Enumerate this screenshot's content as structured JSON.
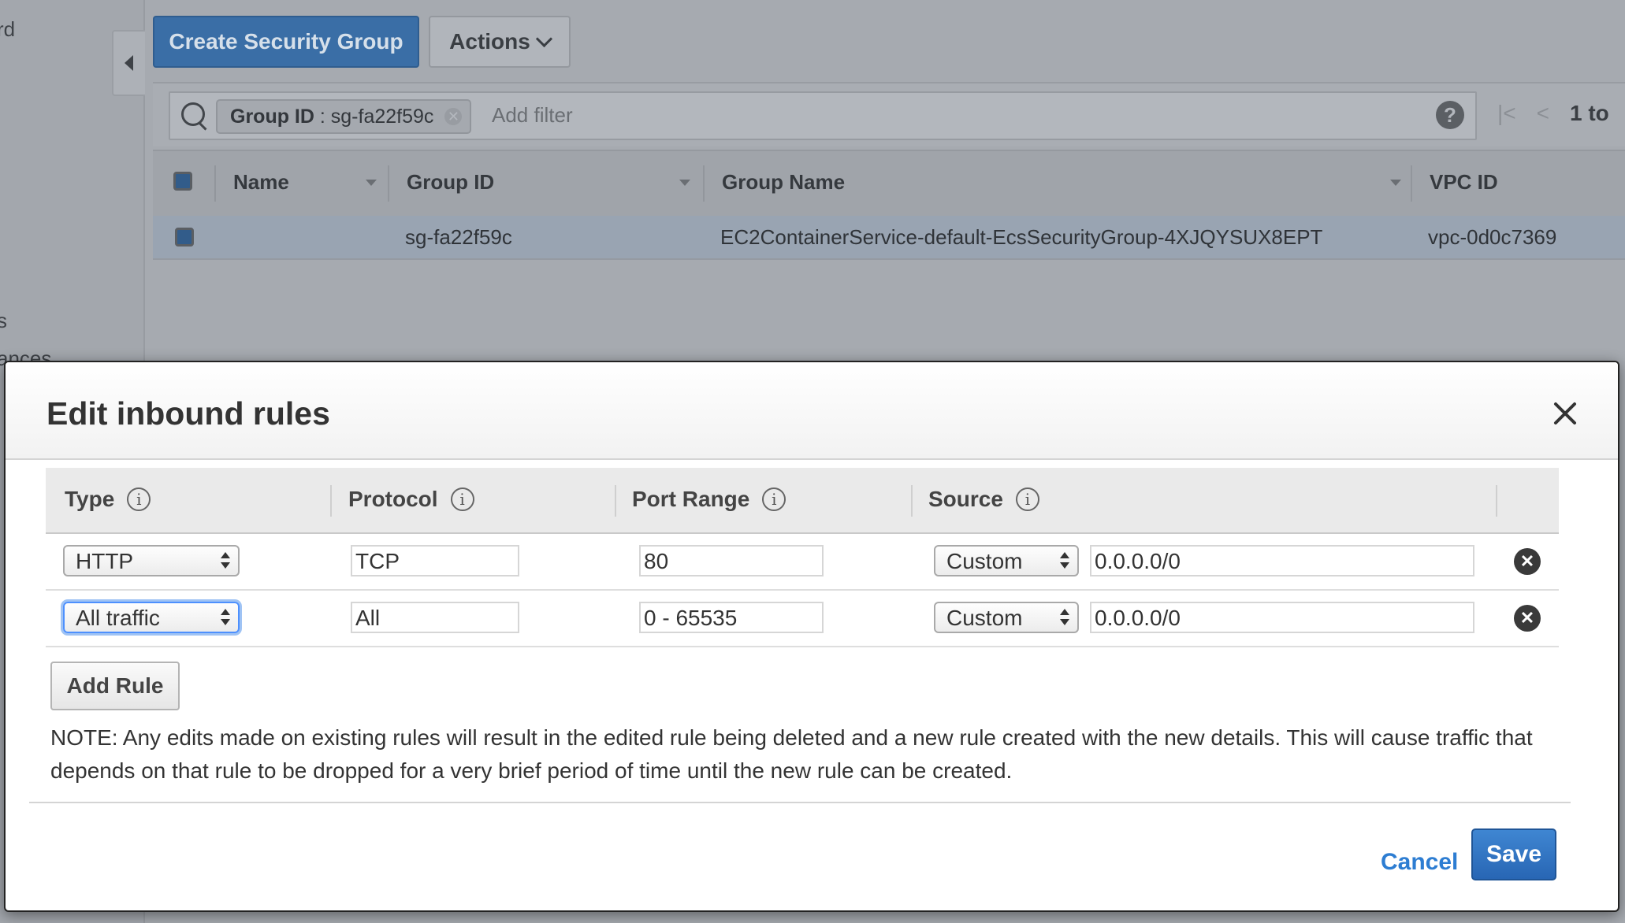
{
  "left_nav": {
    "fragments": [
      "rd",
      "s",
      "ances"
    ]
  },
  "toolbar": {
    "create_label": "Create Security Group",
    "actions_label": "Actions"
  },
  "filter": {
    "chip_key": "Group ID",
    "chip_value": " : sg-fa22f59c",
    "placeholder": "Add filter",
    "help_glyph": "?",
    "pagination": "1 to"
  },
  "grid": {
    "columns": [
      "Name",
      "Group ID",
      "Group Name",
      "VPC ID"
    ],
    "rows": [
      {
        "name": "",
        "group_id": "sg-fa22f59c",
        "group_name": "EC2ContainerService-default-EcsSecurityGroup-4XJQYSUX8EPT",
        "vpc_id": "vpc-0d0c7369"
      }
    ]
  },
  "modal": {
    "title": "Edit inbound rules",
    "columns": {
      "type": "Type",
      "protocol": "Protocol",
      "port_range": "Port Range",
      "source": "Source"
    },
    "info_glyph": "i",
    "remove_glyph": "✕",
    "rules": [
      {
        "type": "HTTP",
        "protocol": "TCP",
        "port_range": "80",
        "source_type": "Custom",
        "source_value": "0.0.0.0/0"
      },
      {
        "type": "All traffic",
        "protocol": "All",
        "port_range": "0 - 65535",
        "source_type": "Custom",
        "source_value": "0.0.0.0/0"
      }
    ],
    "add_rule_label": "Add Rule",
    "note": "NOTE: Any edits made on existing rules will result in the edited rule being deleted and a new rule created with the new details. This will cause traffic that depends on that rule to be dropped for a very brief period of time until the new rule can be created.",
    "cancel_label": "Cancel",
    "save_label": "Save"
  },
  "colors": {
    "primary_button": "#2866b4",
    "link": "#2d7dd2",
    "focus_ring": "#4d90fe"
  }
}
